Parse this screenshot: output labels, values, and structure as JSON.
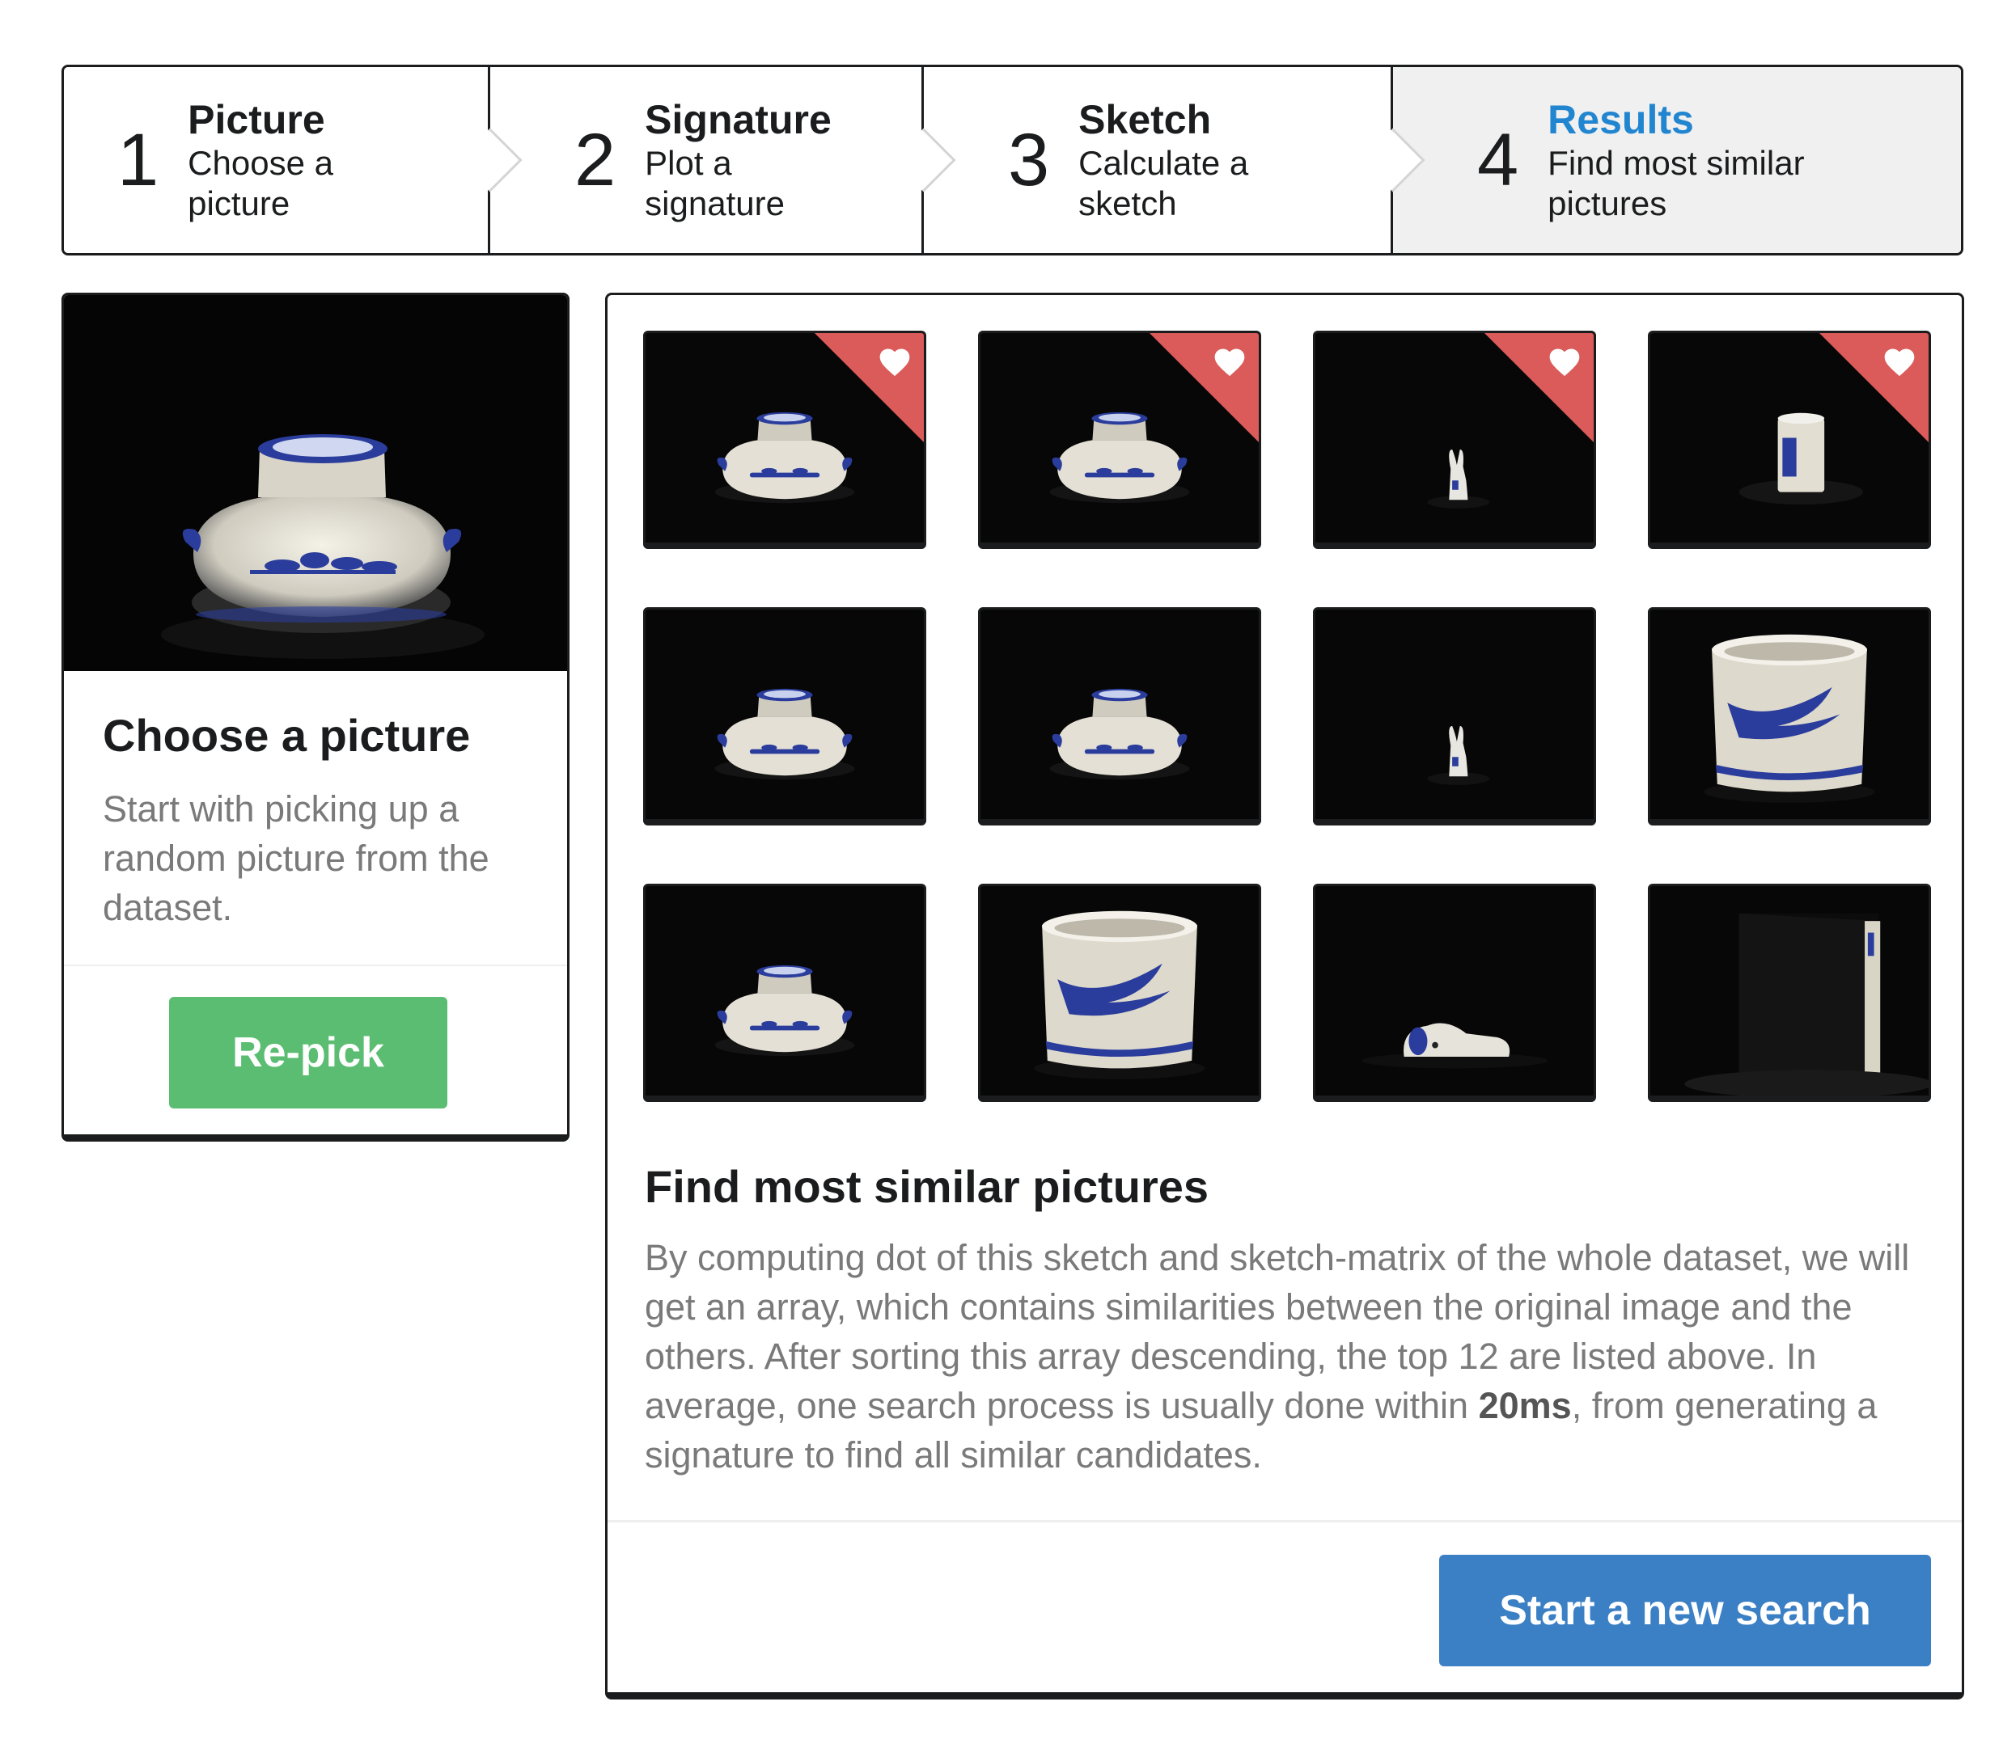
{
  "steps": [
    {
      "number": "1",
      "title": "Picture",
      "desc1": "Choose a",
      "desc2": "picture"
    },
    {
      "number": "2",
      "title": "Signature",
      "desc1": "Plot a",
      "desc2": "signature"
    },
    {
      "number": "3",
      "title": "Sketch",
      "desc1": "Calculate a",
      "desc2": "sketch"
    },
    {
      "number": "4",
      "title": "Results",
      "desc1": "Find most similar",
      "desc2": "pictures"
    }
  ],
  "active_step": 4,
  "left_card": {
    "title": "Choose a picture",
    "description": "Start with picking up a random picture from the dataset.",
    "button_label": "Re-pick"
  },
  "results": {
    "thumbnails": [
      {
        "object": "vase",
        "favorite": true
      },
      {
        "object": "vase",
        "favorite": true
      },
      {
        "object": "rabbit",
        "favorite": true
      },
      {
        "object": "mug-small",
        "favorite": true
      },
      {
        "object": "vase",
        "favorite": false
      },
      {
        "object": "vase",
        "favorite": false
      },
      {
        "object": "rabbit",
        "favorite": false
      },
      {
        "object": "mug-large",
        "favorite": false
      },
      {
        "object": "vase",
        "favorite": false
      },
      {
        "object": "mug-large",
        "favorite": false
      },
      {
        "object": "dog",
        "favorite": false
      },
      {
        "object": "box",
        "favorite": false
      }
    ],
    "title": "Find most similar pictures",
    "desc_before": "By computing dot of this sketch and sketch-matrix of the whole dataset, we will get an array, which contains similarities between the original image and the others. After sorting this array descending, the top 12 are listed above. In average, one search process is usually done within ",
    "desc_bold": "20ms",
    "desc_after": ", from generating a signature to find all similar candidates.",
    "button_label": "Start a new search"
  },
  "colors": {
    "active_step": "#2185d0",
    "repick_button": "#5bbd72",
    "primary_button": "#3b80c4",
    "favorite_corner": "#db5a5a"
  },
  "icons": [
    "heart-icon"
  ]
}
